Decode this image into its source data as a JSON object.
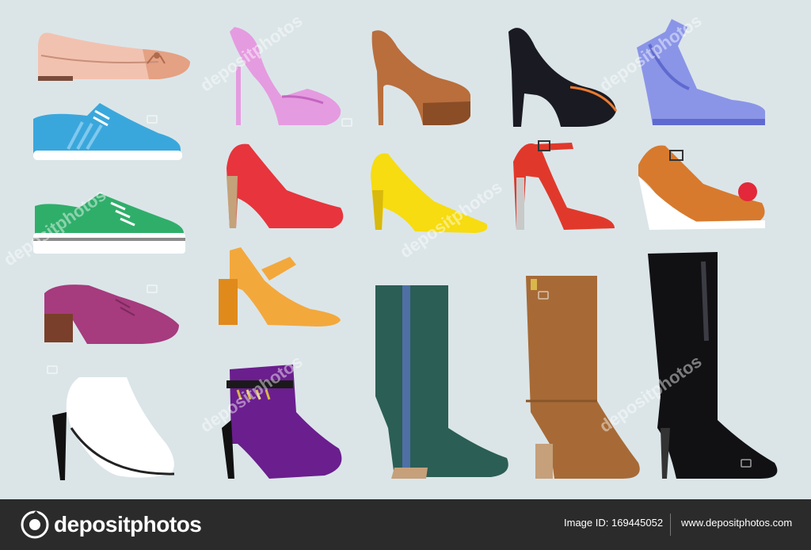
{
  "watermark": {
    "text": "depositphotos"
  },
  "footer": {
    "brand": "depositphotos",
    "image_id_label": "Image ID:",
    "image_id": "169445052",
    "site_url": "www.depositphotos.com"
  },
  "colors": {
    "background": "#dbe5e8",
    "footer": "#2b2b2b",
    "ballet_flat": "#f2c2b0",
    "sneaker_blue": "#3aa7dc",
    "sneaker_green": "#2fae6a",
    "oxford_purple": "#a63b7e",
    "sandal_pink": "#e59be0",
    "platform_brown": "#b96e3c",
    "peep_toe_black": "#1a1a22",
    "wedge_lilac": "#8a95e8",
    "pump_red": "#e8343c",
    "pump_yellow": "#f6dc10",
    "strap_red": "#e0392b",
    "wedge_orange": "#d77a2d",
    "sandal_orange": "#f3a83c",
    "boot_teal": "#2b5e55",
    "boot_tan": "#a76a36",
    "boot_black": "#111114",
    "bootie_purple": "#6b1e8e"
  },
  "icons": [
    "camera-icon",
    "depositphotos-logo-icon"
  ]
}
